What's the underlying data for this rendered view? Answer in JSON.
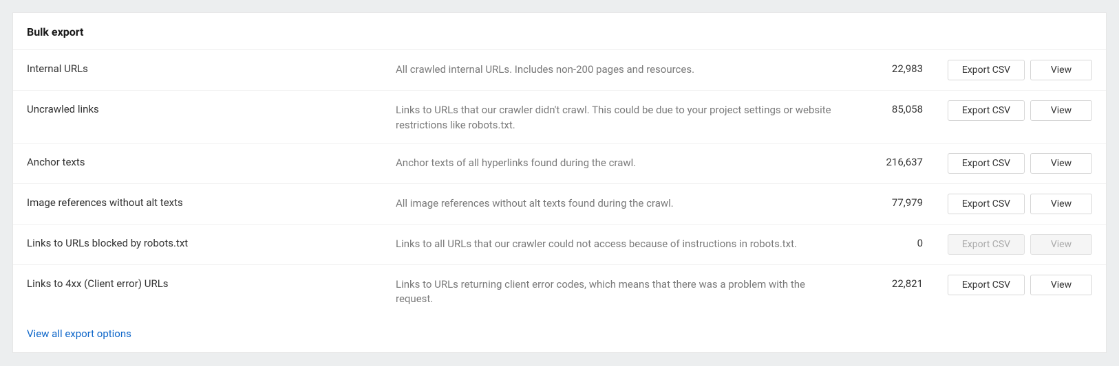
{
  "panel": {
    "title": "Bulk export"
  },
  "rows": [
    {
      "name": "Internal URLs",
      "desc": "All crawled internal URLs. Includes non-200 pages and resources.",
      "count": "22,983",
      "export_label": "Export CSV",
      "view_label": "View",
      "disabled": false
    },
    {
      "name": "Uncrawled links",
      "desc": "Links to URLs that our crawler didn't crawl. This could be due to your project settings or website restrictions like robots.txt.",
      "count": "85,058",
      "export_label": "Export CSV",
      "view_label": "View",
      "disabled": false
    },
    {
      "name": "Anchor texts",
      "desc": "Anchor texts of all hyperlinks found during the crawl.",
      "count": "216,637",
      "export_label": "Export CSV",
      "view_label": "View",
      "disabled": false
    },
    {
      "name": "Image references without alt texts",
      "desc": "All image references without alt texts found during the crawl.",
      "count": "77,979",
      "export_label": "Export CSV",
      "view_label": "View",
      "disabled": false
    },
    {
      "name": "Links to URLs blocked by robots.txt",
      "desc": "Links to all URLs that our crawler could not access because of instructions in robots.txt.",
      "count": "0",
      "export_label": "Export CSV",
      "view_label": "View",
      "disabled": true
    },
    {
      "name": "Links to 4xx (Client error) URLs",
      "desc": "Links to URLs returning client error codes, which means that there was a problem with the request.",
      "count": "22,821",
      "export_label": "Export CSV",
      "view_label": "View",
      "disabled": false
    }
  ],
  "footer": {
    "view_all": "View all export options"
  }
}
